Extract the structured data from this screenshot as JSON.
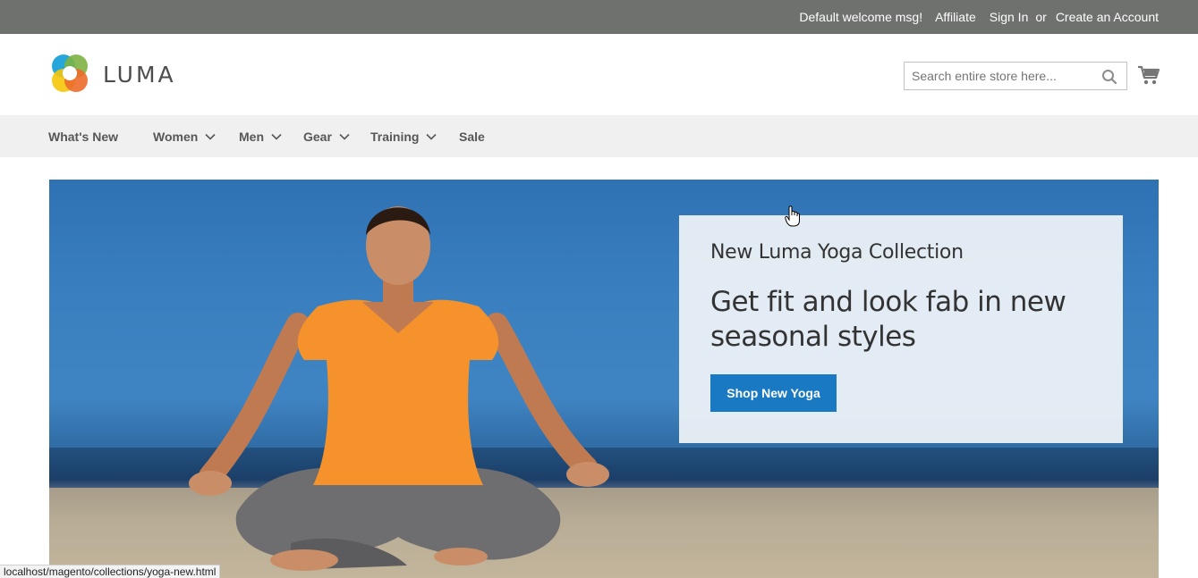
{
  "header_panel": {
    "welcome": "Default welcome msg!",
    "affiliate": "Affiliate",
    "sign_in": "Sign In",
    "or": "or",
    "create_account": "Create an Account"
  },
  "logo": {
    "text": "LUMA"
  },
  "search": {
    "placeholder": "Search entire store here..."
  },
  "nav": {
    "items": [
      {
        "label": "What's New",
        "has_submenu": false
      },
      {
        "label": "Women",
        "has_submenu": true
      },
      {
        "label": "Men",
        "has_submenu": true
      },
      {
        "label": "Gear",
        "has_submenu": true
      },
      {
        "label": "Training",
        "has_submenu": true
      },
      {
        "label": "Sale",
        "has_submenu": false
      }
    ]
  },
  "hero": {
    "subtitle": "New Luma Yoga Collection",
    "title": "Get fit and look fab in new seasonal styles",
    "button": "Shop New Yoga"
  },
  "status_bar": {
    "url": "localhost/magento/collections/yoga-new.html"
  },
  "colors": {
    "accent": "#1979c3",
    "top_bar": "#6e716e",
    "nav_bg": "#f0f0f0"
  }
}
